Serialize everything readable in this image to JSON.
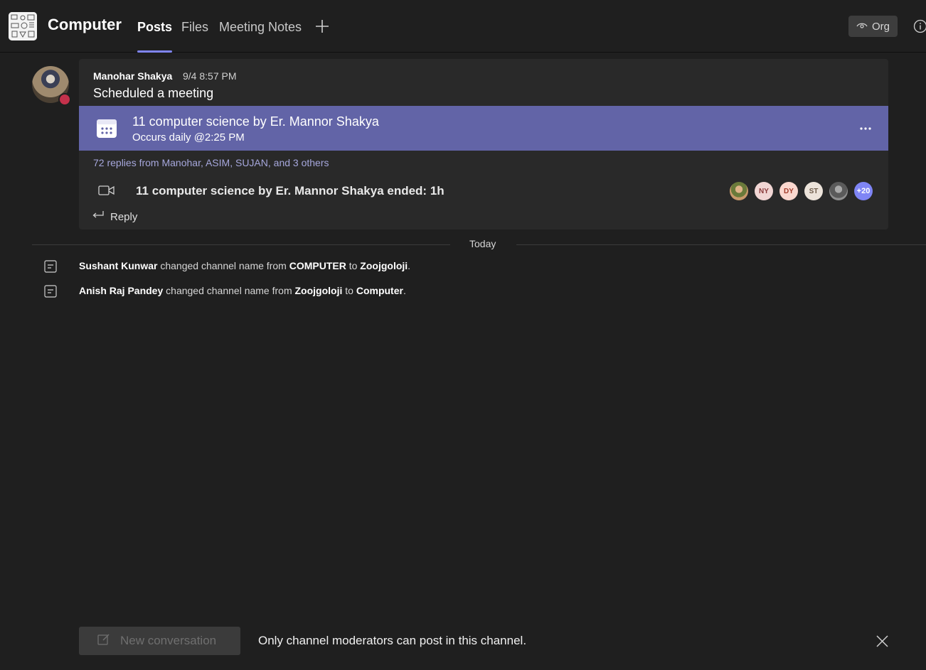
{
  "header": {
    "channel_name": "Computer",
    "tabs": [
      {
        "label": "Posts",
        "active": true
      },
      {
        "label": "Files",
        "active": false
      },
      {
        "label": "Meeting Notes",
        "active": false
      }
    ],
    "add_tab_icon": "plus-icon",
    "org_label": "Org",
    "info_icon": "info-icon"
  },
  "post": {
    "author": "Manohar Shakya",
    "time": "9/4 8:57 PM",
    "message": "Scheduled a meeting",
    "presence_status": "busy",
    "meeting": {
      "title": "11 computer science by Er. Mannor Shakya",
      "recurrence": "Occurs daily @2:25 PM",
      "banner_color": "#6264a7"
    },
    "replies_text": "72 replies from Manohar, ASIM, SUJAN, and 3 others",
    "ended_text": "11 computer science by Er. Mannor Shakya ended: 1h",
    "participants": [
      {
        "type": "photo"
      },
      {
        "initials": "NY"
      },
      {
        "initials": "DY"
      },
      {
        "initials": "ST"
      },
      {
        "type": "photo"
      },
      {
        "more": "+20"
      }
    ],
    "reply_label": "Reply"
  },
  "divider_label": "Today",
  "events": [
    {
      "actor": "Sushant Kunwar",
      "action": "changed channel name from",
      "from": "COMPUTER",
      "to_word": "to",
      "to": "Zoojgoloji",
      "end": "."
    },
    {
      "actor": "Anish Raj Pandey",
      "action": "changed channel name from",
      "from": "Zoojgoloji",
      "to_word": "to",
      "to": "Computer",
      "end": "."
    }
  ],
  "compose": {
    "new_conversation_label": "New conversation",
    "moderator_note": "Only channel moderators can post in this channel."
  },
  "colors": {
    "accent": "#7f85f5",
    "background": "#1f1f1f",
    "card": "#292929",
    "link": "#a6a7dc",
    "presence_busy": "#c4314b"
  }
}
